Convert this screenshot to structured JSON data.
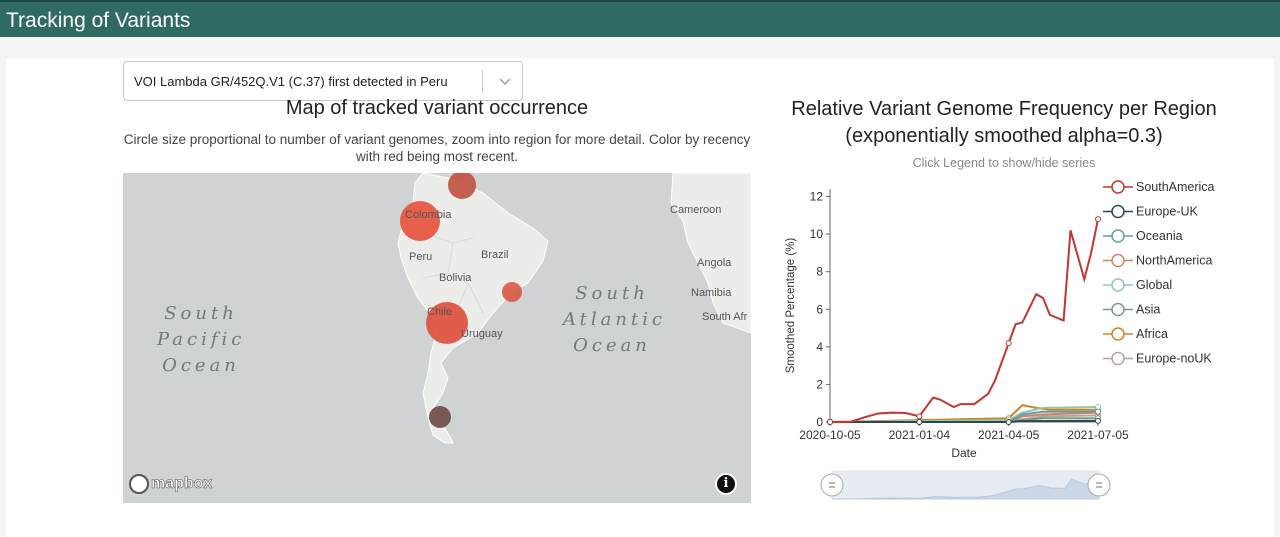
{
  "header": {
    "title": "Tracking of Variants"
  },
  "variant_select": {
    "value": "VOI Lambda GR/452Q.V1 (C.37) first detected in Peru"
  },
  "map": {
    "title": "Map of tracked variant occurrence",
    "subtitle": "Circle size proportional to number of variant genomes, zoom into region for more detail. Color by recency with red being most recent.",
    "oceans": [
      "South Pacific Ocean",
      "South Atlantic Ocean"
    ],
    "places": [
      "Colombia",
      "Peru",
      "Brazil",
      "Bolivia",
      "Chile",
      "Uruguay",
      "Cameroon",
      "Angola",
      "Namibia",
      "South Afr"
    ],
    "attribution": "mapbox",
    "info_icon": "info-icon",
    "markers": [
      {
        "country": "Venezuela",
        "recency_color": "#c0513e"
      },
      {
        "country": "Colombia",
        "recency_color": "#e8503a"
      },
      {
        "country": "Brazil",
        "recency_color": "#d65a42"
      },
      {
        "country": "Chile",
        "recency_color": "#e04e3a"
      },
      {
        "country": "Argentina-south",
        "recency_color": "#6e4a44"
      }
    ]
  },
  "chart_data": {
    "type": "line",
    "title": "Relative Variant Genome Frequency per Region (exponentially smoothed alpha=0.3)",
    "subtitle": "Click Legend to show/hide series",
    "xlabel": "Date",
    "ylabel": "Smoothed Percentage (%)",
    "x_ticks": [
      "2020-10-05",
      "2021-01-04",
      "2021-04-05",
      "2021-07-05"
    ],
    "y_ticks": [
      0,
      2,
      4,
      6,
      8,
      10,
      12
    ],
    "ylim": [
      0,
      12.4
    ],
    "xlim": [
      "2020-10-05",
      "2021-07-05"
    ],
    "legend_position": "right",
    "series": [
      {
        "name": "SouthAmerica",
        "color": "#c23531",
        "points": [
          [
            "2020-10-05",
            0
          ],
          [
            "2020-10-26",
            0
          ],
          [
            "2020-11-09",
            0.25
          ],
          [
            "2020-11-23",
            0.45
          ],
          [
            "2020-12-07",
            0.5
          ],
          [
            "2020-12-21",
            0.48
          ],
          [
            "2021-01-04",
            0.3
          ],
          [
            "2021-01-18",
            1.3
          ],
          [
            "2021-01-25",
            1.2
          ],
          [
            "2021-02-08",
            0.8
          ],
          [
            "2021-02-15",
            0.95
          ],
          [
            "2021-03-01",
            0.95
          ],
          [
            "2021-03-15",
            1.5
          ],
          [
            "2021-03-22",
            2.2
          ],
          [
            "2021-04-05",
            4.2
          ],
          [
            "2021-04-12",
            5.2
          ],
          [
            "2021-04-19",
            5.3
          ],
          [
            "2021-05-03",
            6.8
          ],
          [
            "2021-05-10",
            6.6
          ],
          [
            "2021-05-17",
            5.7
          ],
          [
            "2021-05-31",
            5.4
          ],
          [
            "2021-06-07",
            10.2
          ],
          [
            "2021-06-21",
            7.6
          ],
          [
            "2021-06-28",
            9.0
          ],
          [
            "2021-07-05",
            10.8
          ]
        ]
      },
      {
        "name": "Europe-UK",
        "color": "#2f4554",
        "points": [
          [
            "2020-10-05",
            0
          ],
          [
            "2021-04-05",
            0
          ],
          [
            "2021-04-19",
            0.05
          ],
          [
            "2021-07-05",
            0.06
          ]
        ]
      },
      {
        "name": "Oceania",
        "color": "#61a0a8",
        "points": [
          [
            "2020-10-05",
            0
          ],
          [
            "2021-04-05",
            0
          ],
          [
            "2021-04-19",
            0.4
          ],
          [
            "2021-05-10",
            0.55
          ],
          [
            "2021-07-05",
            0.55
          ]
        ]
      },
      {
        "name": "NorthAmerica",
        "color": "#d48265",
        "points": [
          [
            "2020-10-05",
            0
          ],
          [
            "2021-04-05",
            0
          ],
          [
            "2021-04-19",
            0.3
          ],
          [
            "2021-05-10",
            0.4
          ],
          [
            "2021-07-05",
            0.5
          ]
        ]
      },
      {
        "name": "Global",
        "color": "#91c7ae",
        "points": [
          [
            "2020-10-05",
            0
          ],
          [
            "2021-04-05",
            0.1
          ],
          [
            "2021-04-19",
            0.5
          ],
          [
            "2021-05-10",
            0.75
          ],
          [
            "2021-07-05",
            0.8
          ]
        ]
      },
      {
        "name": "Asia",
        "color": "#749f83",
        "points": [
          [
            "2020-10-05",
            0
          ],
          [
            "2021-04-05",
            0
          ],
          [
            "2021-04-19",
            0.1
          ],
          [
            "2021-05-10",
            0.2
          ],
          [
            "2021-07-05",
            0.2
          ]
        ]
      },
      {
        "name": "Africa",
        "color": "#ca8622",
        "points": [
          [
            "2020-10-05",
            0
          ],
          [
            "2021-04-05",
            0.2
          ],
          [
            "2021-04-19",
            0.9
          ],
          [
            "2021-05-03",
            0.75
          ],
          [
            "2021-05-17",
            0.65
          ],
          [
            "2021-07-05",
            0.65
          ]
        ]
      },
      {
        "name": "Europe-noUK",
        "color": "#bda29a",
        "points": [
          [
            "2020-10-05",
            0
          ],
          [
            "2021-04-05",
            0
          ],
          [
            "2021-04-19",
            0.15
          ],
          [
            "2021-05-10",
            0.3
          ],
          [
            "2021-07-05",
            0.35
          ]
        ]
      }
    ]
  }
}
